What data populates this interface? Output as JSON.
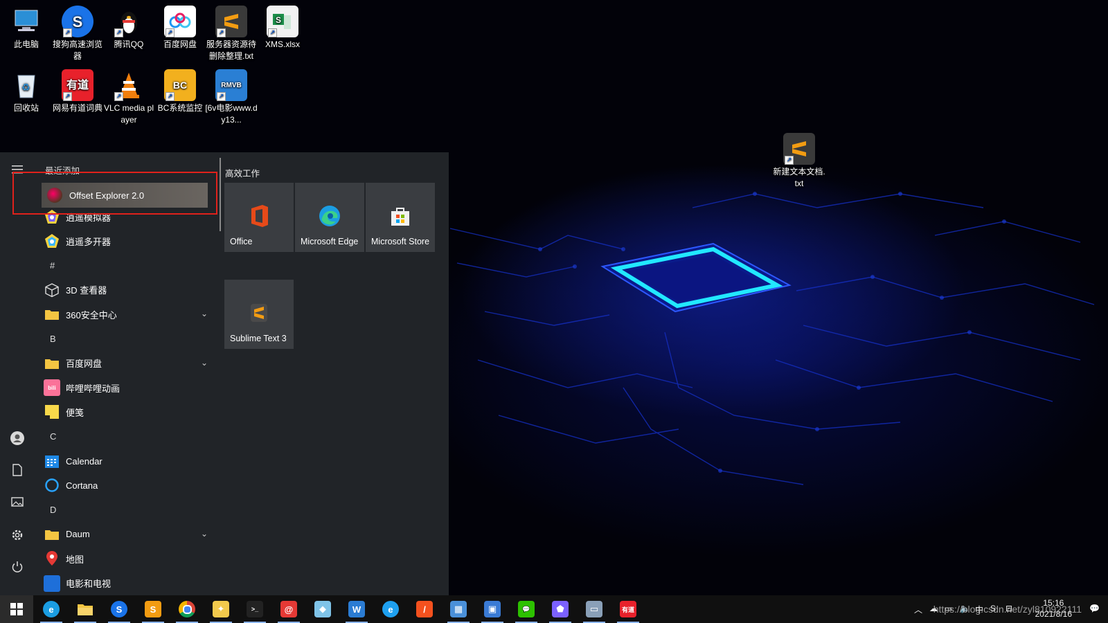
{
  "desktop": {
    "icons": [
      {
        "label": "此电脑",
        "icon": "computer-icon",
        "color": "#2b8fd6"
      },
      {
        "label": "搜狗高速浏览器",
        "icon": "sogou-browser-icon",
        "color": "#1a73e8"
      },
      {
        "label": "腾讯QQ",
        "icon": "qq-penguin-icon",
        "color": "#111111"
      },
      {
        "label": "百度网盘",
        "icon": "baidu-netdisk-icon",
        "color": "#2196f3"
      },
      {
        "label": "服务器资源待删除整理.txt",
        "icon": "sublime-file-icon",
        "color": "#f39c12"
      },
      {
        "label": "XMS.xlsx",
        "icon": "excel-file-icon",
        "color": "#1d8f4a"
      },
      {
        "label": "回收站",
        "icon": "recycle-bin-icon",
        "color": "#8aa0b8"
      },
      {
        "label": "网易有道词典",
        "icon": "youdao-icon",
        "color": "#e8212b",
        "glyph": "有道"
      },
      {
        "label": "VLC media player",
        "icon": "vlc-cone-icon",
        "color": "#f07e0c"
      },
      {
        "label": "BC系统监控",
        "icon": "bc-monitor-icon",
        "color": "#f2b01e"
      },
      {
        "label": "[6v电影www.dy13...",
        "icon": "rmvb-video-icon",
        "color": "#2a7fd4",
        "glyph": "RMVB"
      },
      {
        "label": "新建文本文档.txt",
        "icon": "sublime-file-icon",
        "color": "#f39c12"
      }
    ]
  },
  "start_menu": {
    "recent_header": "最近添加",
    "tiles_header": "高效工作",
    "selected_recent": "Offset Explorer 2.0",
    "apps": [
      {
        "label": "逍遥模拟器",
        "icon": "xiaoyao-emulator-icon",
        "color": "#7b61ff"
      },
      {
        "label": "逍遥多开器",
        "icon": "xiaoyao-multi-icon",
        "color": "#38b6ff"
      },
      {
        "letter": "#"
      },
      {
        "label": "3D 查看器",
        "icon": "cube-icon",
        "color": "#cccccc"
      },
      {
        "label": "360安全中心",
        "icon": "folder-icon",
        "color": "#f4c542",
        "expand": true
      },
      {
        "letter": "B"
      },
      {
        "label": "百度网盘",
        "icon": "folder-icon",
        "color": "#f4c542",
        "expand": true
      },
      {
        "label": "哔哩哔哩动画",
        "icon": "bilibili-icon",
        "color": "#fb7299"
      },
      {
        "label": "便笺",
        "icon": "sticky-notes-icon",
        "color": "#f7d84a"
      },
      {
        "letter": "C"
      },
      {
        "label": "Calendar",
        "icon": "calendar-icon",
        "color": "#1e88e5"
      },
      {
        "label": "Cortana",
        "icon": "cortana-ring-icon",
        "color": "#29a3ff"
      },
      {
        "letter": "D"
      },
      {
        "label": "Daum",
        "icon": "folder-icon",
        "color": "#f4c542",
        "expand": true
      },
      {
        "label": "地图",
        "icon": "map-pin-icon",
        "color": "#e53935"
      },
      {
        "label": "电影和电视",
        "icon": "movies-tv-icon",
        "color": "#1e6fd9"
      }
    ],
    "tiles": [
      {
        "label": "Office",
        "icon": "office-icon",
        "color": "#e64a19"
      },
      {
        "label": "Microsoft Edge",
        "icon": "edge-icon",
        "color": "#1b9de2"
      },
      {
        "label": "Microsoft Store",
        "icon": "store-bag-icon",
        "color": "#ffffff"
      },
      {
        "label": "Sublime Text 3",
        "icon": "sublime-icon",
        "color": "#f39c12"
      }
    ]
  },
  "taskbar": {
    "apps": [
      {
        "name": "edge",
        "icon": "edge-icon",
        "color": "#1b9de2",
        "glyph": "e"
      },
      {
        "name": "file-explorer",
        "icon": "folder-icon",
        "color": "#f4c542",
        "glyph": ""
      },
      {
        "name": "sogou-browser",
        "icon": "sogou-browser-icon",
        "color": "#1a73e8",
        "glyph": "S"
      },
      {
        "name": "sublime",
        "icon": "sublime-icon",
        "color": "#f39c12",
        "glyph": "S"
      },
      {
        "name": "chrome",
        "icon": "chrome-icon",
        "color": "#db4437",
        "glyph": "●"
      },
      {
        "name": "app-6",
        "icon": "bird-icon",
        "color": "#f2c94c",
        "glyph": "✦"
      },
      {
        "name": "terminal",
        "icon": "terminal-icon",
        "color": "#222222",
        "glyph": ">_"
      },
      {
        "name": "app-8",
        "icon": "spiral-icon",
        "color": "#e53935",
        "glyph": "@"
      },
      {
        "name": "app-9",
        "icon": "crystal-icon",
        "color": "#7fc3e8",
        "glyph": "◆"
      },
      {
        "name": "word",
        "icon": "word-icon",
        "color": "#2b7cd3",
        "glyph": "W"
      },
      {
        "name": "ie",
        "icon": "ie-icon",
        "color": "#1ea0f0",
        "glyph": "e"
      },
      {
        "name": "app-12",
        "icon": "pen-icon",
        "color": "#f4511e",
        "glyph": "/"
      },
      {
        "name": "app-13",
        "icon": "building-icon",
        "color": "#4a90d9",
        "glyph": "▦"
      },
      {
        "name": "app-14",
        "icon": "image-app-icon",
        "color": "#3a7bd5",
        "glyph": "▣"
      },
      {
        "name": "wechat",
        "icon": "wechat-icon",
        "color": "#2dc100",
        "glyph": "💬"
      },
      {
        "name": "xiaoyao",
        "icon": "xiaoyao-emulator-icon",
        "color": "#7b61ff",
        "glyph": "⬟"
      },
      {
        "name": "app-17",
        "icon": "remote-desktop-icon",
        "color": "#8aa0b8",
        "glyph": "▭"
      },
      {
        "name": "youdao",
        "icon": "youdao-icon",
        "color": "#e8212b",
        "glyph": "有道"
      }
    ],
    "tray": {
      "ime": "中",
      "time": "15:16",
      "date": "2021/8/16",
      "watermark": "https://blog.csdn.net/zyl810922111"
    }
  }
}
